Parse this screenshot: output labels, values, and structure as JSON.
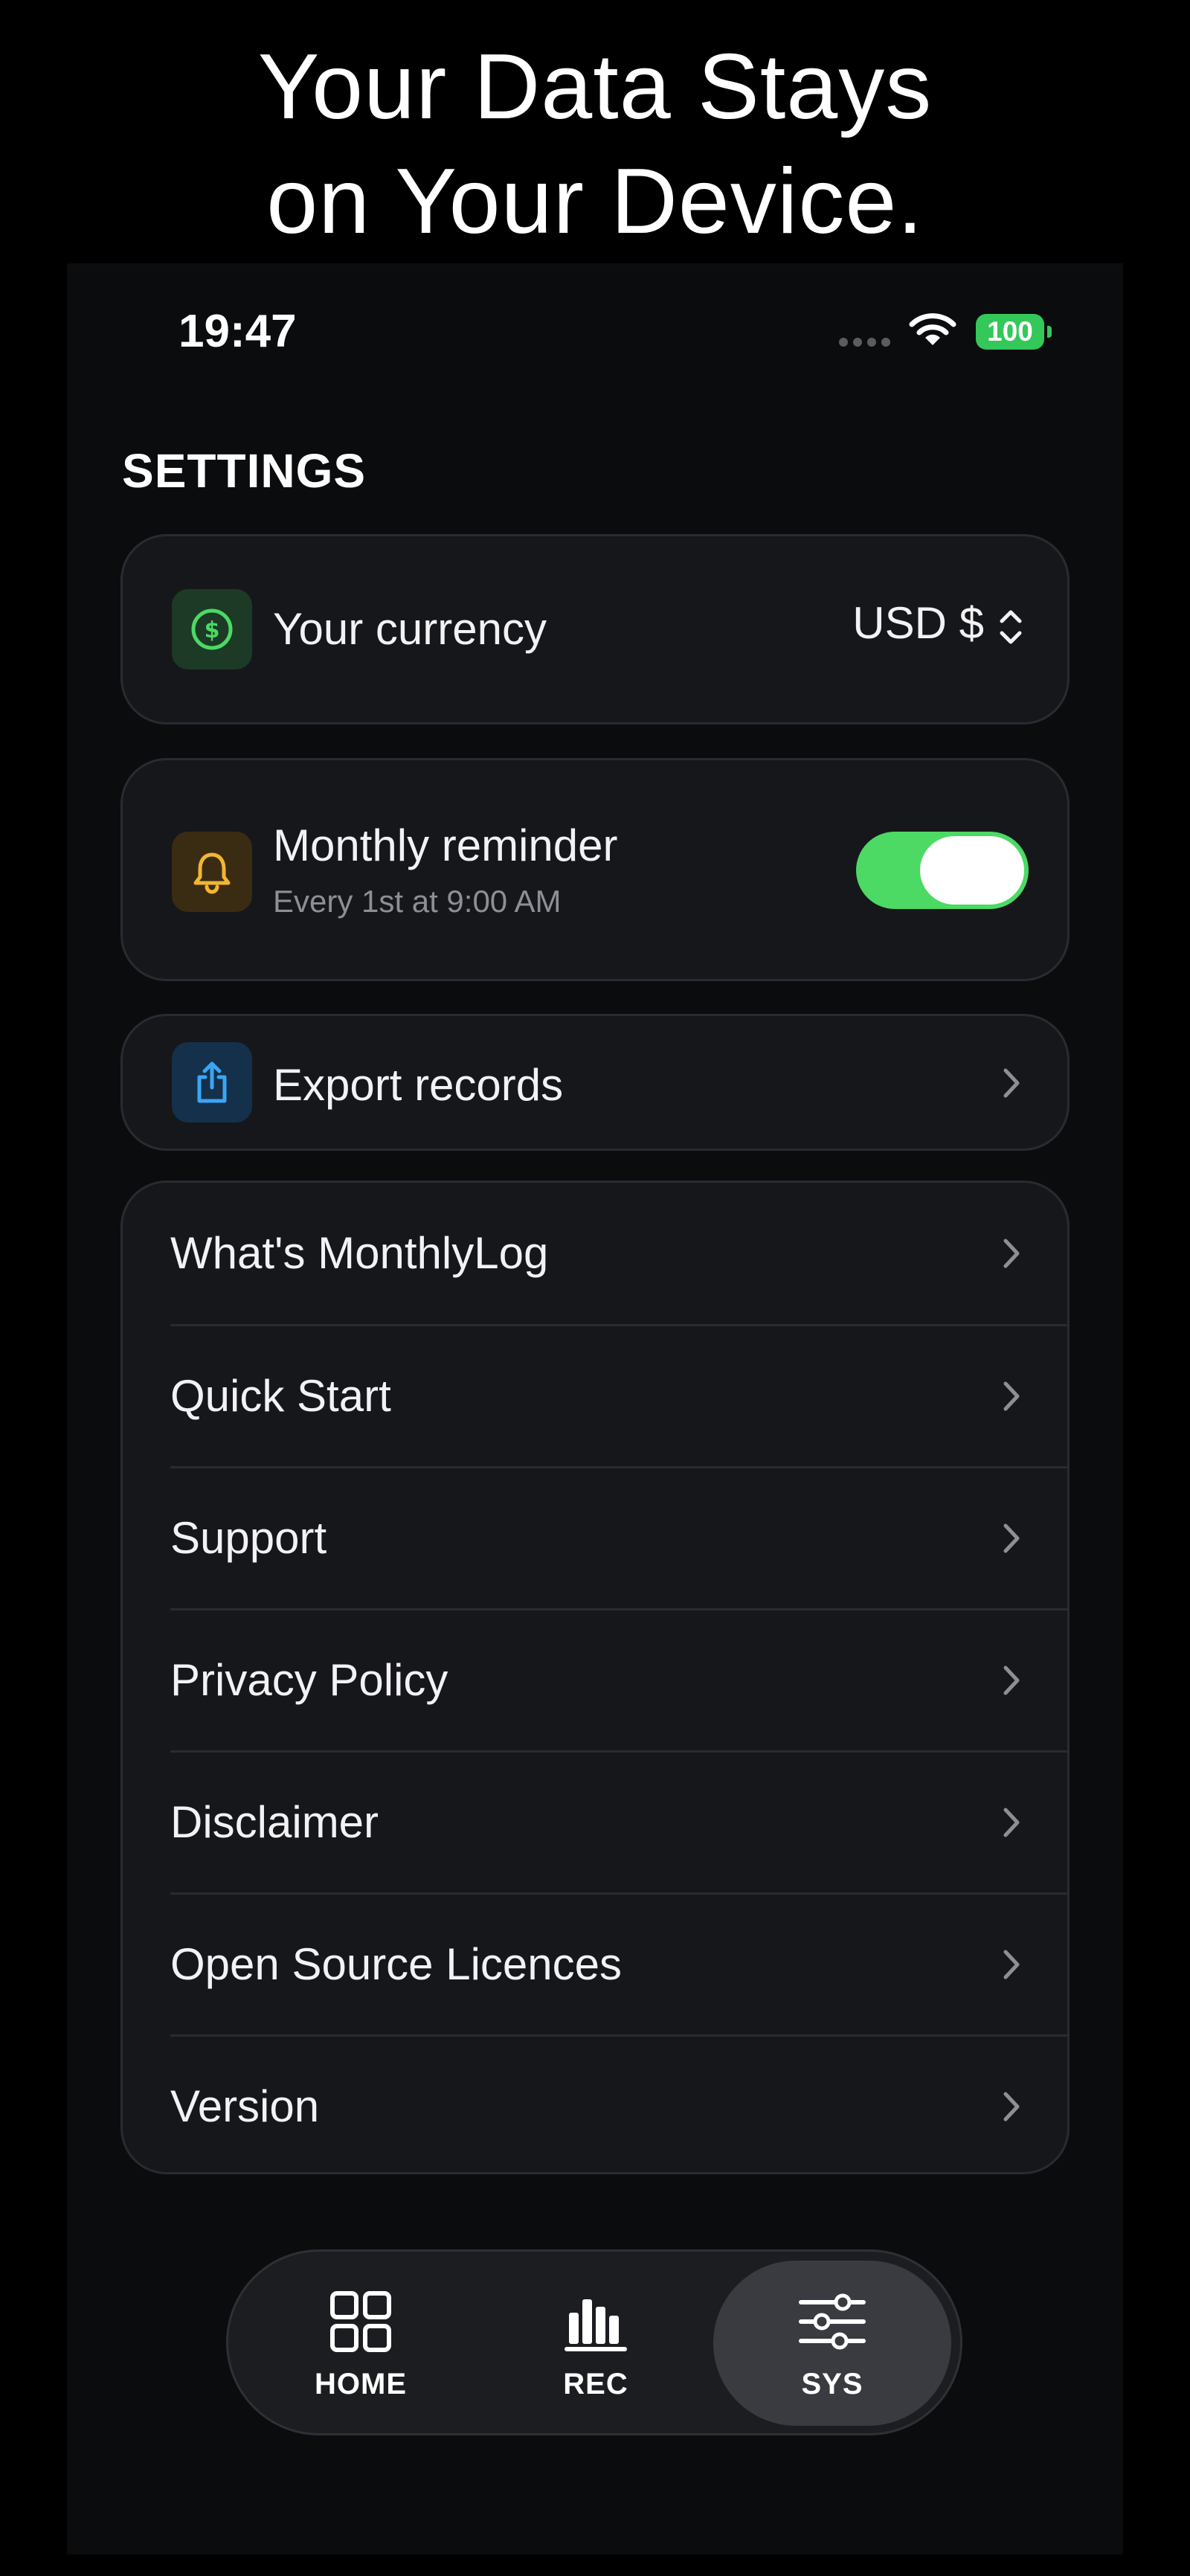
{
  "headline": {
    "line1": "Your Data Stays",
    "line2": "on Your Device."
  },
  "status_bar": {
    "time": "19:47",
    "battery": "100",
    "battery_color": "#34c759"
  },
  "settings": {
    "title": "SETTINGS",
    "currency": {
      "icon": "dollar-circle-icon",
      "label": "Your currency",
      "value": "USD  $"
    },
    "reminder": {
      "icon": "bell-icon",
      "label": "Monthly reminder",
      "sub": "Every 1st at 9:00 AM",
      "enabled": true,
      "toggle_color": "#4cd964"
    },
    "export": {
      "icon": "share-icon",
      "label": "Export records"
    },
    "links": [
      {
        "label": "What's MonthlyLog"
      },
      {
        "label": "Quick Start"
      },
      {
        "label": "Support"
      },
      {
        "label": "Privacy Policy"
      },
      {
        "label": "Disclaimer"
      },
      {
        "label": "Open Source Licences"
      },
      {
        "label": "Version"
      }
    ]
  },
  "tabbar": {
    "tabs": [
      {
        "label": "HOME",
        "icon": "grid-icon",
        "active": false
      },
      {
        "label": "REC",
        "icon": "bar-chart-icon",
        "active": false
      },
      {
        "label": "SYS",
        "icon": "sliders-icon",
        "active": true
      }
    ]
  }
}
